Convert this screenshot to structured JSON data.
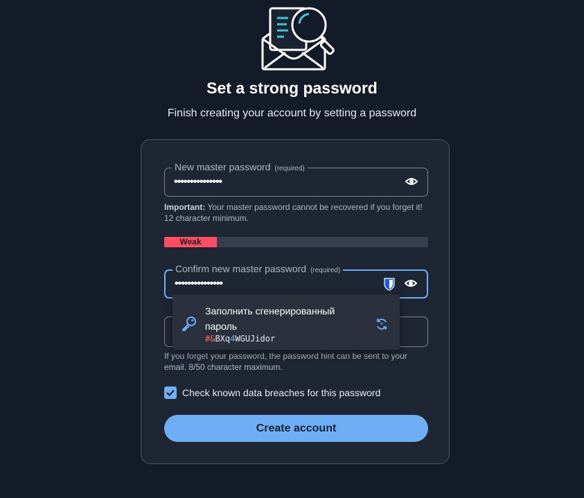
{
  "header": {
    "title": "Set a strong password",
    "subtitle": "Finish creating your account by setting a password",
    "hero_icon": "envelope-magnifier-icon"
  },
  "form": {
    "new_password": {
      "label": "New master password",
      "required": "(required)",
      "value_masked": "•••••••••••••••",
      "toggle_icon": "eye-icon"
    },
    "important_hint": {
      "label": "Important:",
      "text": " Your master password cannot be recovered if you forget it!",
      "minimum": "12 character minimum."
    },
    "strength": {
      "label": "Weak",
      "level": 0.2,
      "color": "#ff4d61"
    },
    "confirm_password": {
      "label": "Confirm new master password",
      "required": "(required)",
      "value_masked": "•••••••••••••••",
      "extension_icon": "bitwarden-shield-icon",
      "toggle_icon": "eye-icon"
    },
    "password_hint": {
      "text": "If you forget your password, the password hint can be sent to your",
      "text2": "email. 8/50 character maximum."
    },
    "breach_check": {
      "label": "Check known data breaches for this password",
      "checked": true
    },
    "submit_label": "Create account"
  },
  "autofill_popup": {
    "line1": "Заполнить сгенерированный",
    "line2": "пароль",
    "generated_password": {
      "p1": "#&",
      "p2": "BXq",
      "p3": "4",
      "p4": "WGUJidor"
    },
    "key_icon": "key-icon",
    "refresh_icon": "refresh-icon"
  },
  "colors": {
    "background": "#131b28",
    "card": "#1f2633",
    "accent": "#6eaef5",
    "weak": "#ff4d61"
  }
}
